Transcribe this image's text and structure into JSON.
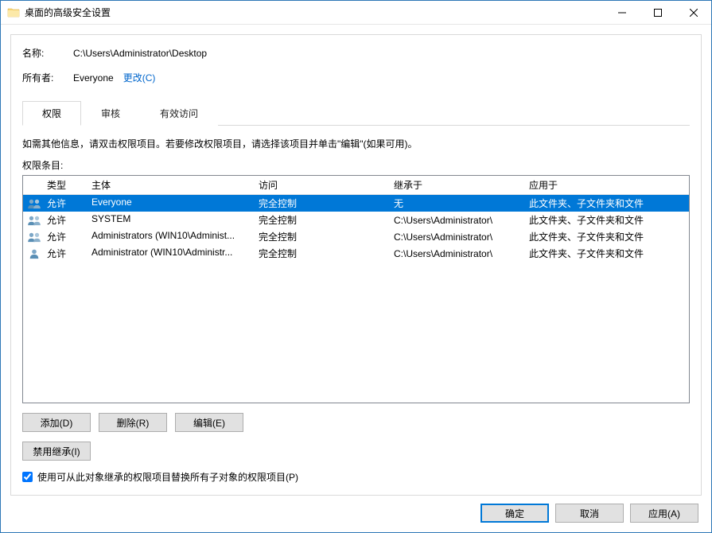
{
  "titlebar": {
    "title": "桌面的高级安全设置"
  },
  "info": {
    "name_label": "名称:",
    "name_value": "C:\\Users\\Administrator\\Desktop",
    "owner_label": "所有者:",
    "owner_value": "Everyone",
    "change_link": "更改(C)"
  },
  "tabs": {
    "permissions": "权限",
    "auditing": "审核",
    "effective": "有效访问"
  },
  "instruction": "如需其他信息，请双击权限项目。若要修改权限项目，请选择该项目并单击\"编辑\"(如果可用)。",
  "list_label": "权限条目:",
  "columns": {
    "type": "类型",
    "principal": "主体",
    "access": "访问",
    "inherited": "继承于",
    "applies": "应用于"
  },
  "entries": [
    {
      "icon": "users",
      "type": "允许",
      "principal": "Everyone",
      "access": "完全控制",
      "inherited": "无",
      "applies": "此文件夹、子文件夹和文件",
      "selected": true
    },
    {
      "icon": "users",
      "type": "允许",
      "principal": "SYSTEM",
      "access": "完全控制",
      "inherited": "C:\\Users\\Administrator\\",
      "applies": "此文件夹、子文件夹和文件",
      "selected": false
    },
    {
      "icon": "users",
      "type": "允许",
      "principal": "Administrators (WIN10\\Administ...",
      "access": "完全控制",
      "inherited": "C:\\Users\\Administrator\\",
      "applies": "此文件夹、子文件夹和文件",
      "selected": false
    },
    {
      "icon": "user",
      "type": "允许",
      "principal": "Administrator (WIN10\\Administr...",
      "access": "完全控制",
      "inherited": "C:\\Users\\Administrator\\",
      "applies": "此文件夹、子文件夹和文件",
      "selected": false
    }
  ],
  "buttons": {
    "add": "添加(D)",
    "remove": "删除(R)",
    "edit": "编辑(E)",
    "disable_inherit": "禁用继承(I)",
    "replace_children": "使用可从此对象继承的权限项目替换所有子对象的权限项目(P)",
    "ok": "确定",
    "cancel": "取消",
    "apply": "应用(A)"
  }
}
